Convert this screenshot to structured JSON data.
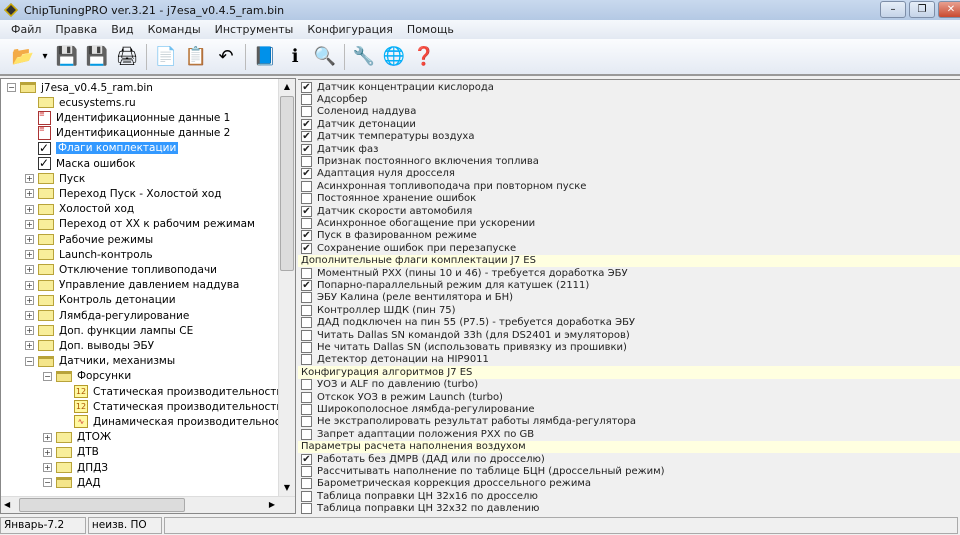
{
  "window": {
    "title": "ChipTuningPRO ver.3.21 - j7esa_v0.4.5_ram.bin"
  },
  "menu": [
    "Файл",
    "Правка",
    "Вид",
    "Команды",
    "Инструменты",
    "Конфигурация",
    "Помощь"
  ],
  "toolbar": [
    {
      "icon": "open-folder-icon",
      "glyph": "📂"
    },
    {
      "icon": "dropdown-arrow-icon",
      "glyph": "▾"
    },
    {
      "icon": "save-icon",
      "glyph": "💾"
    },
    {
      "icon": "save-as-icon",
      "glyph": "💾"
    },
    {
      "icon": "print-icon",
      "glyph": "🖨"
    },
    {
      "sep": true
    },
    {
      "icon": "copy-icon",
      "glyph": "📄"
    },
    {
      "icon": "paste-icon",
      "glyph": "📋"
    },
    {
      "icon": "undo-icon",
      "glyph": "↶"
    },
    {
      "sep": true
    },
    {
      "icon": "document-compare-icon",
      "glyph": "📘"
    },
    {
      "icon": "info-icon",
      "glyph": "ℹ"
    },
    {
      "icon": "search-icon",
      "glyph": "🔍"
    },
    {
      "sep": true
    },
    {
      "icon": "tools-icon",
      "glyph": "🔧"
    },
    {
      "icon": "network-icon",
      "glyph": "🌐"
    },
    {
      "icon": "help-icon",
      "glyph": "❓"
    }
  ],
  "tree": [
    {
      "label": "j7esa_v0.4.5_ram.bin",
      "level": 0,
      "exp": "-",
      "icon": "folder-open"
    },
    {
      "label": "ecusystems.ru",
      "level": 1,
      "icon": "folder"
    },
    {
      "label": "Идентификационные данные 1",
      "level": 1,
      "icon": "doc"
    },
    {
      "label": "Идентификационные данные 2",
      "level": 1,
      "icon": "doc"
    },
    {
      "label": "Флаги комплектации",
      "level": 1,
      "icon": "check",
      "selected": true
    },
    {
      "label": "Маска ошибок",
      "level": 1,
      "icon": "check"
    },
    {
      "label": "Пуск",
      "level": 1,
      "exp": "+",
      "icon": "folder"
    },
    {
      "label": "Переход Пуск - Холостой ход",
      "level": 1,
      "exp": "+",
      "icon": "folder"
    },
    {
      "label": "Холостой ход",
      "level": 1,
      "exp": "+",
      "icon": "folder"
    },
    {
      "label": "Переход от ХХ к рабочим режимам",
      "level": 1,
      "exp": "+",
      "icon": "folder"
    },
    {
      "label": "Рабочие режимы",
      "level": 1,
      "exp": "+",
      "icon": "folder"
    },
    {
      "label": "Launch-контроль",
      "level": 1,
      "exp": "+",
      "icon": "folder"
    },
    {
      "label": "Отключение топливоподачи",
      "level": 1,
      "exp": "+",
      "icon": "folder"
    },
    {
      "label": "Управление давлением наддува",
      "level": 1,
      "exp": "+",
      "icon": "folder"
    },
    {
      "label": "Контроль детонации",
      "level": 1,
      "exp": "+",
      "icon": "folder"
    },
    {
      "label": "Лямбда-регулирование",
      "level": 1,
      "exp": "+",
      "icon": "folder"
    },
    {
      "label": "Доп. функции лампы СЕ",
      "level": 1,
      "exp": "+",
      "icon": "folder"
    },
    {
      "label": "Доп. выводы ЭБУ",
      "level": 1,
      "exp": "+",
      "icon": "folder"
    },
    {
      "label": "Датчики, механизмы",
      "level": 1,
      "exp": "-",
      "icon": "folder-open"
    },
    {
      "label": "Форсунки",
      "level": 2,
      "exp": "-",
      "icon": "folder-open"
    },
    {
      "label": "Статическая производительность фо",
      "level": 3,
      "icon": "num"
    },
    {
      "label": "Статическая производительность фо",
      "level": 3,
      "icon": "num"
    },
    {
      "label": "Динамическая производительность",
      "level": 3,
      "icon": "graph"
    },
    {
      "label": "ДТОЖ",
      "level": 2,
      "exp": "+",
      "icon": "folder"
    },
    {
      "label": "ДТВ",
      "level": 2,
      "exp": "+",
      "icon": "folder"
    },
    {
      "label": "ДПДЗ",
      "level": 2,
      "exp": "+",
      "icon": "folder"
    },
    {
      "label": "ДАД",
      "level": 2,
      "exp": "-",
      "icon": "folder-open"
    }
  ],
  "flags": [
    {
      "label": "Датчик концентрации кислорода",
      "checked": true
    },
    {
      "label": "Адсорбер",
      "checked": false
    },
    {
      "label": "Соленоид наддува",
      "checked": false
    },
    {
      "label": "Датчик детонации",
      "checked": true
    },
    {
      "label": "Датчик температуры воздуха",
      "checked": true
    },
    {
      "label": "Датчик фаз",
      "checked": true
    },
    {
      "label": "Признак постоянного включения топлива",
      "checked": false
    },
    {
      "label": "Адаптация нуля дросселя",
      "checked": true
    },
    {
      "label": "Асинхронная топливоподача при повторном пуске",
      "checked": false
    },
    {
      "label": "Постоянное хранение ошибок",
      "checked": false
    },
    {
      "label": "Датчик скорости автомобиля",
      "checked": true
    },
    {
      "label": "Асинхронное обогащение при ускорении",
      "checked": false
    },
    {
      "label": "Пуск в фазированном режиме",
      "checked": true
    },
    {
      "label": "Сохранение ошибок при перезапуске",
      "checked": true
    },
    {
      "header": "Дополнительные флаги комплектации J7 ES"
    },
    {
      "label": "Моментный РХХ (пины 10 и 46) - требуется доработка ЭБУ",
      "checked": false
    },
    {
      "label": "Попарно-параллельный режим для катушек (2111)",
      "checked": true
    },
    {
      "label": "ЭБУ Калина (реле вентилятора и БН)",
      "checked": false
    },
    {
      "label": "Контроллер ШДК (пин 75)",
      "checked": false
    },
    {
      "label": "ДАД подключен на пин 55 (P7.5) - требуется доработка ЭБУ",
      "checked": false
    },
    {
      "label": "Читать Dallas SN командой 33h (для DS2401 и эмуляторов)",
      "checked": false
    },
    {
      "label": "Не читать Dallas SN (использовать привязку из прошивки)",
      "checked": false
    },
    {
      "label": "Детектор детонации на HIP9011",
      "checked": false
    },
    {
      "header": "Конфигурация алгоритмов J7 ES"
    },
    {
      "label": "УОЗ и ALF по давлению (turbo)",
      "checked": false
    },
    {
      "label": "Отскок УОЗ в режим Launch (turbo)",
      "checked": false
    },
    {
      "label": "Широкополосное лямбда-регулирование",
      "checked": false
    },
    {
      "label": "Не экстраполировать результат работы лямбда-регулятора",
      "checked": false
    },
    {
      "label": "Запрет адаптации положения РХХ по GB",
      "checked": false
    },
    {
      "header": "Параметры расчета наполнения воздухом"
    },
    {
      "label": "Работать без ДМРВ (ДАД или по дросселю)",
      "checked": true
    },
    {
      "label": "Рассчитывать наполнение по таблице БЦН (дроссельный режим)",
      "checked": false
    },
    {
      "label": "Барометрическая коррекция дроссельного режима",
      "checked": false
    },
    {
      "label": "Таблица поправки ЦН 32x16 по дросселю",
      "checked": false
    },
    {
      "label": "Таблица поправки ЦН 32x32 по давлению",
      "checked": false
    }
  ],
  "status": {
    "ecu": "Январь-7.2",
    "firmware": "неизв. ПО"
  }
}
